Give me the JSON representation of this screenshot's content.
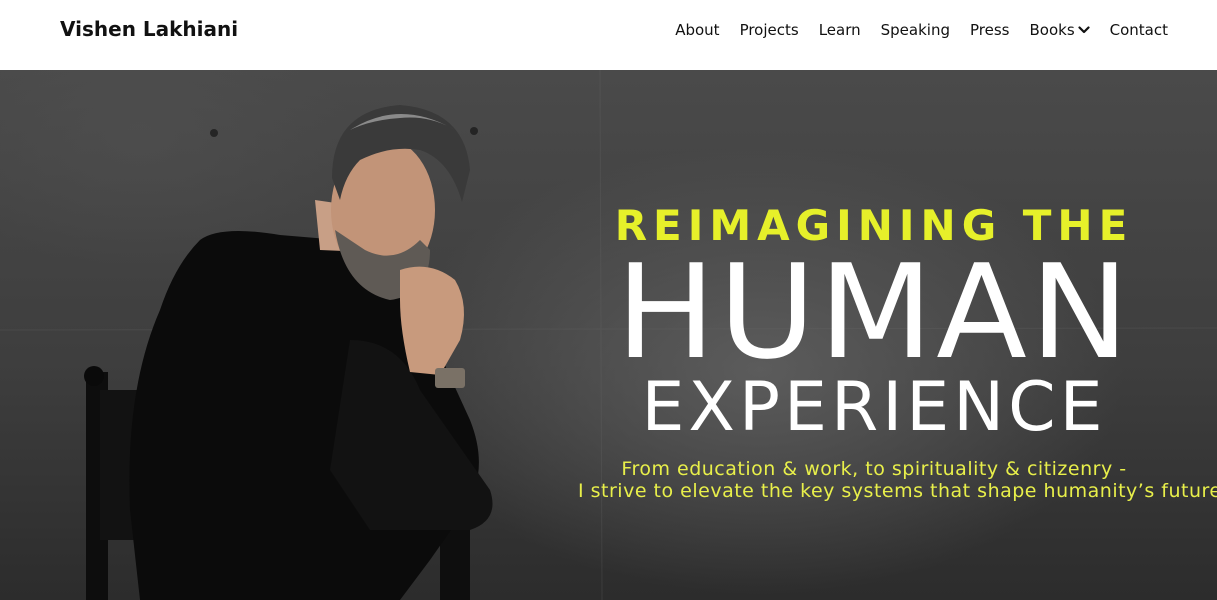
{
  "header": {
    "brand": "Vishen Lakhiani",
    "nav": [
      {
        "label": "About"
      },
      {
        "label": "Projects"
      },
      {
        "label": "Learn"
      },
      {
        "label": "Speaking"
      },
      {
        "label": "Press"
      },
      {
        "label": "Books",
        "icon": "chevron-down-icon"
      },
      {
        "label": "Contact"
      }
    ]
  },
  "hero": {
    "kicker": "REIMAGINING THE",
    "headline": "HUMAN",
    "subhead": "EXPERIENCE",
    "tagline_line1": "From education & work, to spirituality & citizenry -",
    "tagline_line2": "I strive to elevate the key systems that shape humanity’s future",
    "portrait": "man-in-black-turtleneck-seated-in-chair",
    "colors": {
      "accent": "#e6f02a",
      "background": "#3e3e3e",
      "headline": "#ffffff"
    }
  }
}
